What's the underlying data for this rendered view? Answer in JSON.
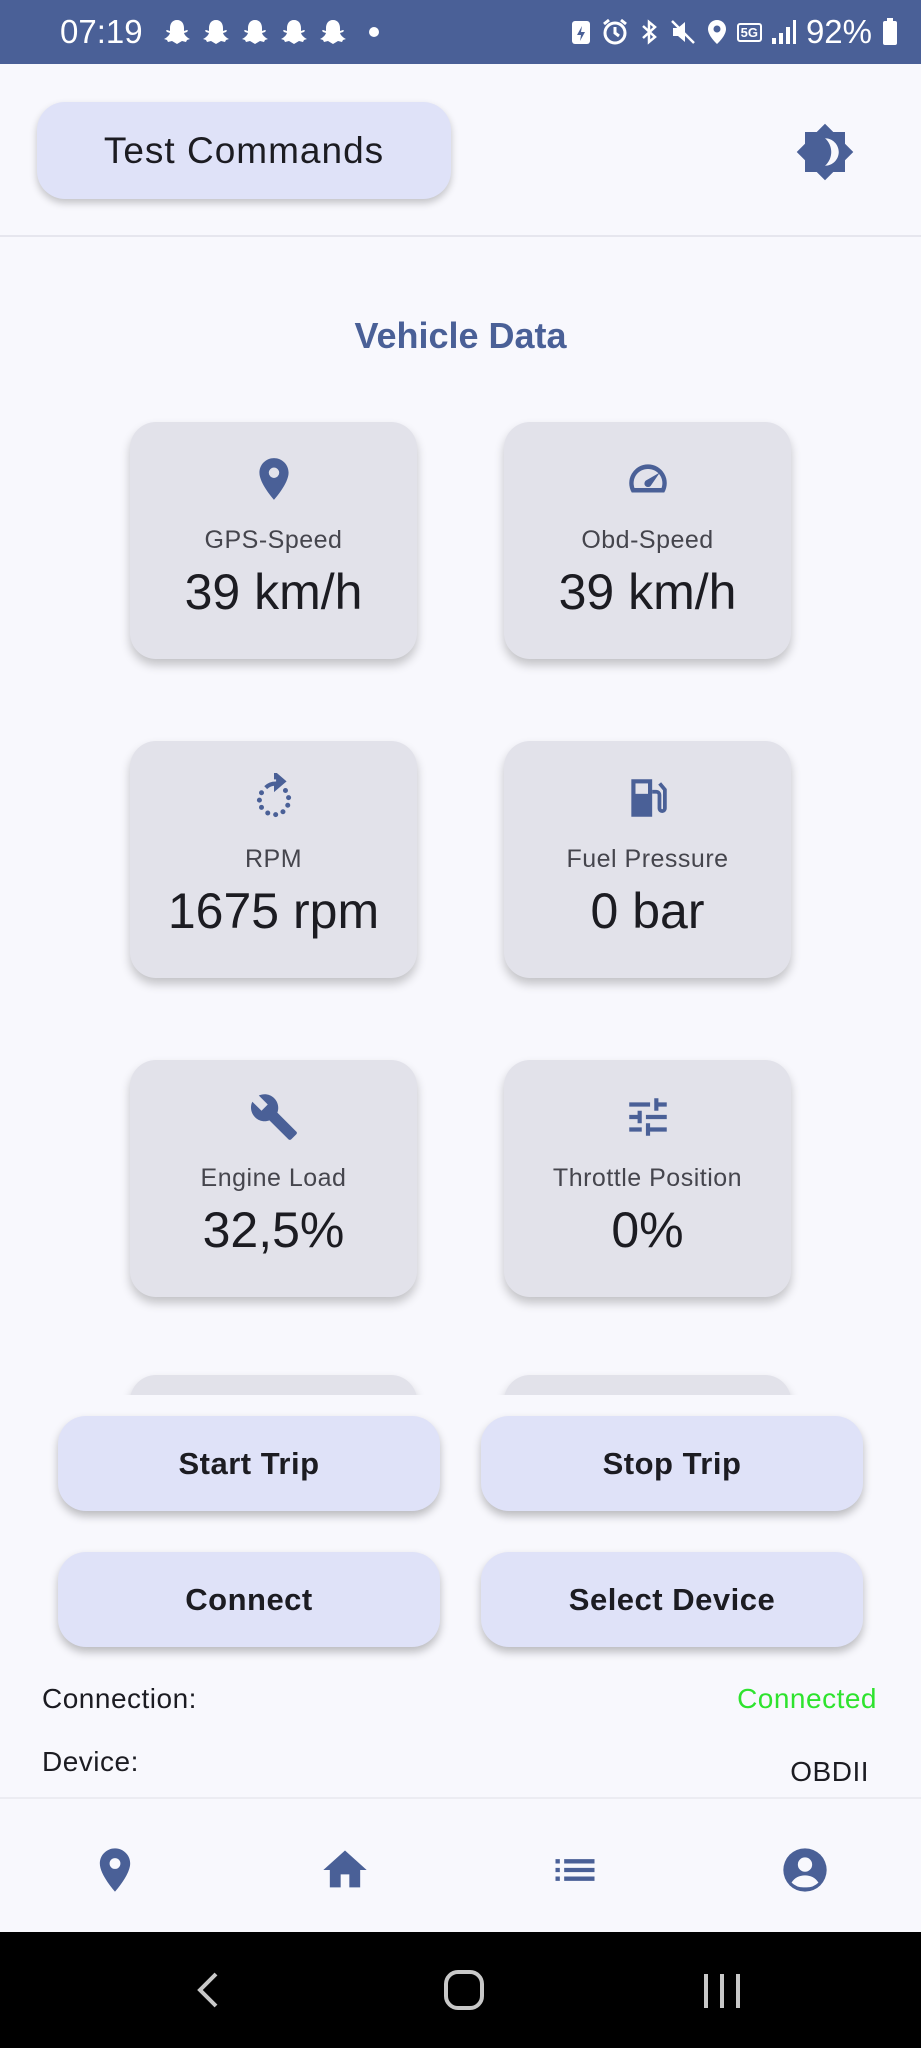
{
  "status_bar": {
    "time": "07:19",
    "battery": "92%",
    "network": "5G"
  },
  "header": {
    "test_commands_label": "Test Commands",
    "theme_icon": "brightness-icon"
  },
  "section_title": "Vehicle Data",
  "cards": [
    {
      "label": "GPS-Speed",
      "value": "39 km/h",
      "icon": "location-pin-icon"
    },
    {
      "label": "Obd-Speed",
      "value": "39 km/h",
      "icon": "speedometer-icon"
    },
    {
      "label": "RPM",
      "value": "1675 rpm",
      "icon": "rotate-icon"
    },
    {
      "label": "Fuel Pressure",
      "value": "0 bar",
      "icon": "fuel-pump-icon"
    },
    {
      "label": "Engine Load",
      "value": "32,5%",
      "icon": "wrench-icon"
    },
    {
      "label": "Throttle Position",
      "value": "0%",
      "icon": "sliders-icon"
    }
  ],
  "actions": {
    "start_trip": "Start Trip",
    "stop_trip": "Stop Trip",
    "connect": "Connect",
    "select_device": "Select Device"
  },
  "info": {
    "connection_label": "Connection:",
    "connection_value": "Connected",
    "device_label": "Device:",
    "device_value": "OBDII"
  },
  "colors": {
    "primary": "#4a6097",
    "connected": "#2ee32e",
    "card_bg": "#e2e2ea",
    "button_bg": "#dfe2f8"
  },
  "bottom_nav": [
    "location-pin-icon",
    "home-icon",
    "list-icon",
    "account-icon"
  ]
}
